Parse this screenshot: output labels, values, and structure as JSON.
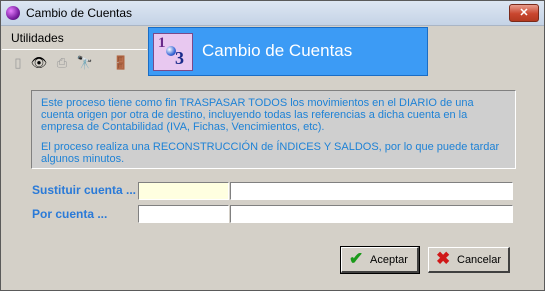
{
  "window": {
    "title": "Cambio de Cuentas",
    "close_symbol": "✕"
  },
  "menu": {
    "items": [
      {
        "label": "Utilidades"
      }
    ]
  },
  "toolbar": {
    "buttons": [
      {
        "name": "new-document-icon",
        "glyph": "▯"
      },
      {
        "name": "view-eye-icon",
        "glyph": "👁"
      },
      {
        "name": "print-icon",
        "glyph": "⎙"
      },
      {
        "name": "binoculars-icon",
        "glyph": "🔭"
      },
      {
        "name": "exit-door-icon",
        "glyph": "🚪"
      }
    ]
  },
  "header": {
    "title": "Cambio de Cuentas",
    "logo_top": "1",
    "logo_bottom": "3"
  },
  "info": {
    "paragraph1": "Este proceso tiene como fin TRASPASAR TODOS los movimientos en el DIARIO de una cuenta origen por otra de destino, incluyendo todas las referencias a dicha cuenta en la empresa de Contabilidad (IVA, Fichas, Vencimientos, etc).",
    "paragraph2": "El proceso realiza una RECONSTRUCCIÓN de ÍNDICES Y SALDOS, por lo que puede tardar algunos minutos."
  },
  "form": {
    "substitute_label": "Sustituir cuenta ...",
    "substitute_code": "",
    "substitute_name": "",
    "replacement_label": "Por cuenta ...",
    "replacement_code": "",
    "replacement_name": ""
  },
  "buttons": {
    "accept": {
      "label": "Aceptar",
      "glyph": "✔",
      "color": "#1a9a1a"
    },
    "cancel": {
      "label": "Cancelar",
      "glyph": "✖",
      "color": "#d01818"
    }
  },
  "colors": {
    "header_bg": "#3c9bf5",
    "info_text": "#1e82d6",
    "label_text": "#2a7ad8",
    "focused_field": "#ffffe0"
  }
}
